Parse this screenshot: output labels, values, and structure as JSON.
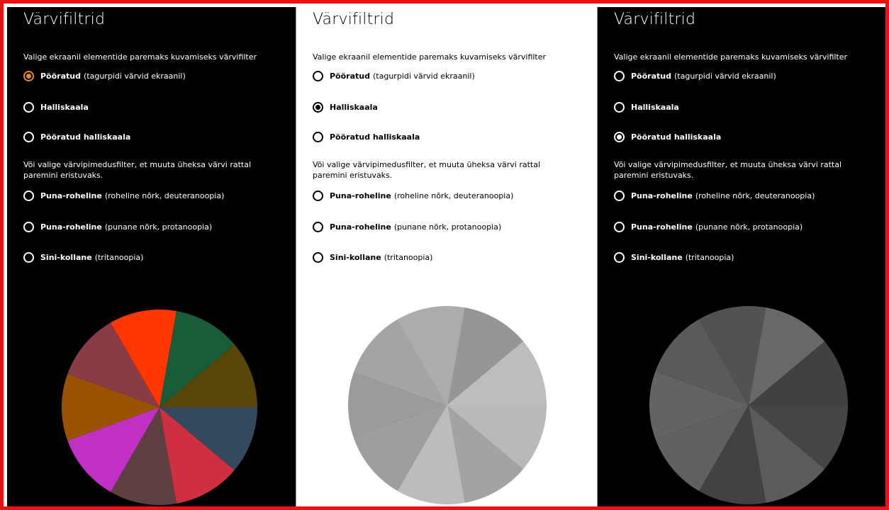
{
  "panels": [
    {
      "title": "Värvifiltrid",
      "description": "Valige ekraanil elementide paremaks kuvamiseks värvifilter",
      "filters": [
        {
          "label": "Pööratud",
          "detail": "(tagurpidi värvid ekraanil)",
          "selected": true
        },
        {
          "label": "Halliskaala",
          "detail": "",
          "selected": false
        },
        {
          "label": "Pööratud halliskaala",
          "detail": "",
          "selected": false
        }
      ],
      "cb_description": "Või valige värvipimedusfilter, et muuta üheksa värvi rattal paremini eristuvaks.",
      "cb_filters": [
        {
          "label": "Puna-roheline",
          "detail": "(roheline nõrk, deuteranoopia)",
          "selected": false
        },
        {
          "label": "Puna-roheline",
          "detail": "(punane nõrk, protanoopia)",
          "selected": false
        },
        {
          "label": "Sini-kollane",
          "detail": "(tritanoopia)",
          "selected": false
        }
      ],
      "wheel_colors": [
        "#334a5e",
        "#ce3040",
        "#5e4040",
        "#c030c2",
        "#995300",
        "#893c46",
        "#ff3600",
        "#185d3a",
        "#574608"
      ]
    },
    {
      "title": "Värvifiltrid",
      "description": "Valige ekraanil elementide paremaks kuvamiseks värvifilter",
      "filters": [
        {
          "label": "Pööratud",
          "detail": "(tagurpidi värvid ekraanil)",
          "selected": false
        },
        {
          "label": "Halliskaala",
          "detail": "",
          "selected": true
        },
        {
          "label": "Pööratud halliskaala",
          "detail": "",
          "selected": false
        }
      ],
      "cb_description": "Või valige värvipimedusfilter, et muuta üheksa värvi rattal paremini eristuvaks.",
      "cb_filters": [
        {
          "label": "Puna-roheline",
          "detail": "(roheline nõrk, deuteranoopia)",
          "selected": false
        },
        {
          "label": "Puna-roheline",
          "detail": "(punane nõrk, protanoopia)",
          "selected": false
        },
        {
          "label": "Sini-kollane",
          "detail": "(tritanoopia)",
          "selected": false
        }
      ],
      "wheel_colors": [
        "#b9b9b9",
        "#a3a3a3",
        "#bcbcbc",
        "#9e9e9e",
        "#9b9b9b",
        "#a4a4a4",
        "#acacac",
        "#969696",
        "#bdbdbd"
      ]
    },
    {
      "title": "Värvifiltrid",
      "description": "Valige ekraanil elementide paremaks kuvamiseks värvifilter",
      "filters": [
        {
          "label": "Pööratud",
          "detail": "(tagurpidi värvid ekraanil)",
          "selected": false
        },
        {
          "label": "Halliskaala",
          "detail": "",
          "selected": false
        },
        {
          "label": "Pööratud halliskaala",
          "detail": "",
          "selected": true
        }
      ],
      "cb_description": "Või valige värvipimedusfilter, et muuta üheksa värvi rattal paremini eristuvaks.",
      "cb_filters": [
        {
          "label": "Puna-roheline",
          "detail": "(roheline nõrk, deuteranoopia)",
          "selected": false
        },
        {
          "label": "Puna-roheline",
          "detail": "(punane nõrk, protanoopia)",
          "selected": false
        },
        {
          "label": "Sini-kollane",
          "detail": "(tritanoopia)",
          "selected": false
        }
      ],
      "wheel_colors": [
        "#454545",
        "#5b5b5b",
        "#424242",
        "#606060",
        "#636363",
        "#5a5a5a",
        "#525252",
        "#686868",
        "#414141"
      ]
    }
  ],
  "accent": "#e8862b",
  "frame_color": "#ee1111"
}
